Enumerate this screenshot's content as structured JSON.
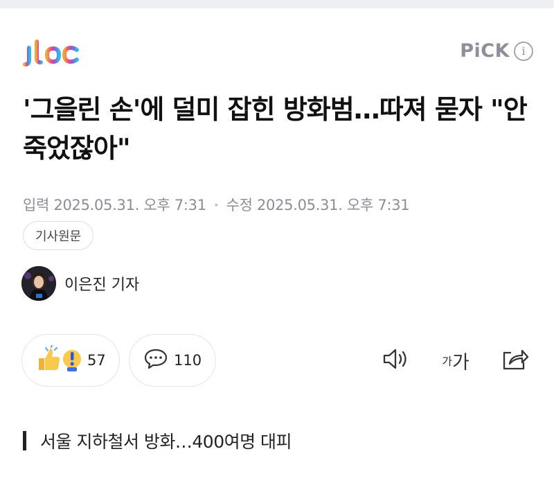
{
  "brand": {
    "logo_text": "jtbc",
    "pick_label": "PiCK",
    "info_icon": "info-icon"
  },
  "article": {
    "headline": "'그을린 손'에 덜미 잡힌 방화범…따져 묻자 \"안 죽었잖아\"",
    "published_label": "입력",
    "published": "2025.05.31. 오후 7:31",
    "modified_label": "수정",
    "modified": "2025.05.31. 오후 7:31",
    "original_button": "기사원문",
    "author": "이은진 기자"
  },
  "reactions": {
    "like_count": "57",
    "comment_count": "110"
  },
  "tools": {
    "font_small": "가",
    "font_large": "가"
  },
  "subheading": "서울 지하철서 방화…400여명 대피",
  "colors": {
    "text": "#111111",
    "meta": "#8a8e94",
    "border": "#e3e5e8"
  }
}
